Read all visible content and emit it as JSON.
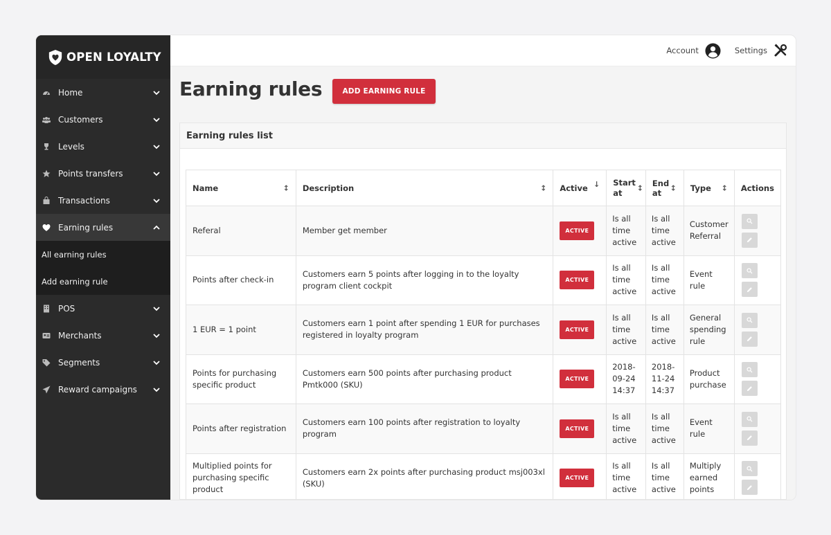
{
  "brand": {
    "name": "OPEN LOYALTY"
  },
  "sidebar": {
    "items": [
      {
        "label": "Home",
        "icon": "dashboard-icon"
      },
      {
        "label": "Customers",
        "icon": "users-icon"
      },
      {
        "label": "Levels",
        "icon": "trophy-icon"
      },
      {
        "label": "Points transfers",
        "icon": "star-icon"
      },
      {
        "label": "Transactions",
        "icon": "bag-icon"
      },
      {
        "label": "Earning rules",
        "icon": "heart-icon"
      },
      {
        "label": "POS",
        "icon": "building-icon"
      },
      {
        "label": "Merchants",
        "icon": "id-card-icon"
      },
      {
        "label": "Segments",
        "icon": "tag-icon"
      },
      {
        "label": "Reward campaigns",
        "icon": "send-icon"
      }
    ],
    "sub_items": [
      "All earning rules",
      "Add earning rule"
    ]
  },
  "topbar": {
    "account_label": "Account",
    "settings_label": "Settings"
  },
  "page": {
    "title": "Earning rules",
    "add_button": "ADD EARNING RULE"
  },
  "panel": {
    "title": "Earning rules list"
  },
  "table": {
    "headers": [
      "Name",
      "Description",
      "Active",
      "Start at",
      "End at",
      "Type",
      "Actions"
    ],
    "rows": [
      {
        "name": "Referal",
        "description": "Member get member",
        "status": "ACTIVE",
        "start": "Is all time active",
        "end": "Is all time active",
        "type": "Customer Referral"
      },
      {
        "name": "Points after check-in",
        "description": "Customers earn 5 points after logging in to the loyalty program client cockpit",
        "status": "ACTIVE",
        "start": "Is all time active",
        "end": "Is all time active",
        "type": "Event rule"
      },
      {
        "name": "1 EUR = 1 point",
        "description": "Customers earn 1 point after spending 1 EUR for purchases registered in loyalty program",
        "status": "ACTIVE",
        "start": "Is all time active",
        "end": "Is all time active",
        "type": "General spending rule"
      },
      {
        "name": "Points for purchasing specific product",
        "description": "Customers earn 500 points after purchasing product Pmtk000 (SKU)",
        "status": "ACTIVE",
        "start": "2018-09-24 14:37",
        "end": "2018-11-24 14:37",
        "type": "Product purchase"
      },
      {
        "name": "Points after registration",
        "description": "Customers earn 100 points after registration to loyalty program",
        "status": "ACTIVE",
        "start": "Is all time active",
        "end": "Is all time active",
        "type": "Event rule"
      },
      {
        "name": "Multiplied points for purchasing specific product",
        "description": "Customers earn 2x points after purchasing product msj003xl (SKU)",
        "status": "ACTIVE",
        "start": "Is all time active",
        "end": "Is all time active",
        "type": "Multiply earned points"
      }
    ]
  },
  "colors": {
    "accent": "#d12f3c",
    "sidebar_bg": "#2b2b2b"
  }
}
